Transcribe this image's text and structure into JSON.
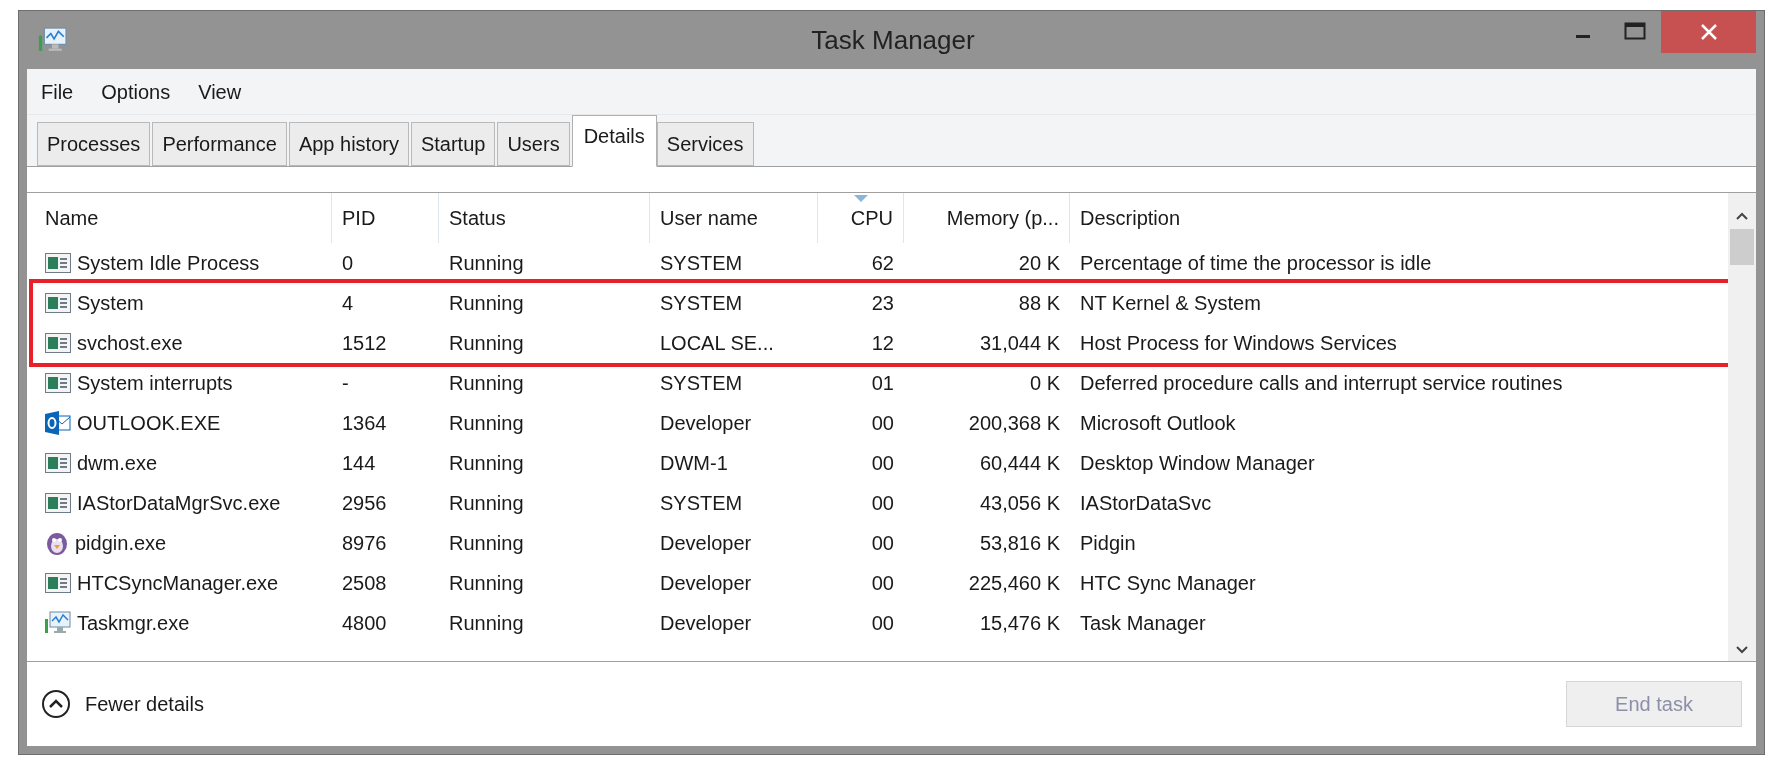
{
  "window": {
    "title": "Task Manager"
  },
  "menu": [
    "File",
    "Options",
    "View"
  ],
  "tabs": [
    {
      "label": "Processes",
      "selected": false
    },
    {
      "label": "Performance",
      "selected": false
    },
    {
      "label": "App history",
      "selected": false
    },
    {
      "label": "Startup",
      "selected": false
    },
    {
      "label": "Users",
      "selected": false
    },
    {
      "label": "Details",
      "selected": true
    },
    {
      "label": "Services",
      "selected": false
    }
  ],
  "table": {
    "columns": [
      {
        "label": "Name",
        "sorted": false
      },
      {
        "label": "PID",
        "sorted": false
      },
      {
        "label": "Status",
        "sorted": false
      },
      {
        "label": "User name",
        "sorted": false
      },
      {
        "label": "CPU",
        "sorted": true
      },
      {
        "label": "Memory (p...",
        "sorted": false
      },
      {
        "label": "Description",
        "sorted": false
      }
    ],
    "rows": [
      {
        "kind": "app",
        "highlighted": false,
        "cells": [
          "System Idle Process",
          "0",
          "Running",
          "SYSTEM",
          "62",
          "20 K",
          "Percentage of time the processor is idle"
        ]
      },
      {
        "kind": "app",
        "highlighted": true,
        "cells": [
          "System",
          "4",
          "Running",
          "SYSTEM",
          "23",
          "88 K",
          "NT Kernel & System"
        ]
      },
      {
        "kind": "app",
        "highlighted": true,
        "cells": [
          "svchost.exe",
          "1512",
          "Running",
          "LOCAL SE...",
          "12",
          "31,044 K",
          "Host Process for Windows Services"
        ]
      },
      {
        "kind": "app",
        "highlighted": false,
        "cells": [
          "System interrupts",
          "-",
          "Running",
          "SYSTEM",
          "01",
          "0 K",
          "Deferred procedure calls and interrupt service routines"
        ]
      },
      {
        "kind": "outlook",
        "highlighted": false,
        "cells": [
          "OUTLOOK.EXE",
          "1364",
          "Running",
          "Developer",
          "00",
          "200,368 K",
          "Microsoft Outlook"
        ]
      },
      {
        "kind": "app",
        "highlighted": false,
        "cells": [
          "dwm.exe",
          "144",
          "Running",
          "DWM-1",
          "00",
          "60,444 K",
          "Desktop Window Manager"
        ]
      },
      {
        "kind": "app",
        "highlighted": false,
        "cells": [
          "IAStorDataMgrSvc.exe",
          "2956",
          "Running",
          "SYSTEM",
          "00",
          "43,056 K",
          "IAStorDataSvc"
        ]
      },
      {
        "kind": "pidgin",
        "highlighted": false,
        "cells": [
          "pidgin.exe",
          "8976",
          "Running",
          "Developer",
          "00",
          "53,816 K",
          "Pidgin"
        ]
      },
      {
        "kind": "app",
        "highlighted": false,
        "cells": [
          "HTCSyncManager.exe",
          "2508",
          "Running",
          "Developer",
          "00",
          "225,460 K",
          "HTC Sync Manager"
        ]
      },
      {
        "kind": "taskmgr",
        "highlighted": false,
        "cells": [
          "Taskmgr.exe",
          "4800",
          "Running",
          "Developer",
          "00",
          "15,476 K",
          "Task Manager"
        ]
      }
    ]
  },
  "footer": {
    "details_link": "Fewer details",
    "end_task": {
      "label": "End task",
      "disabled": true
    }
  }
}
